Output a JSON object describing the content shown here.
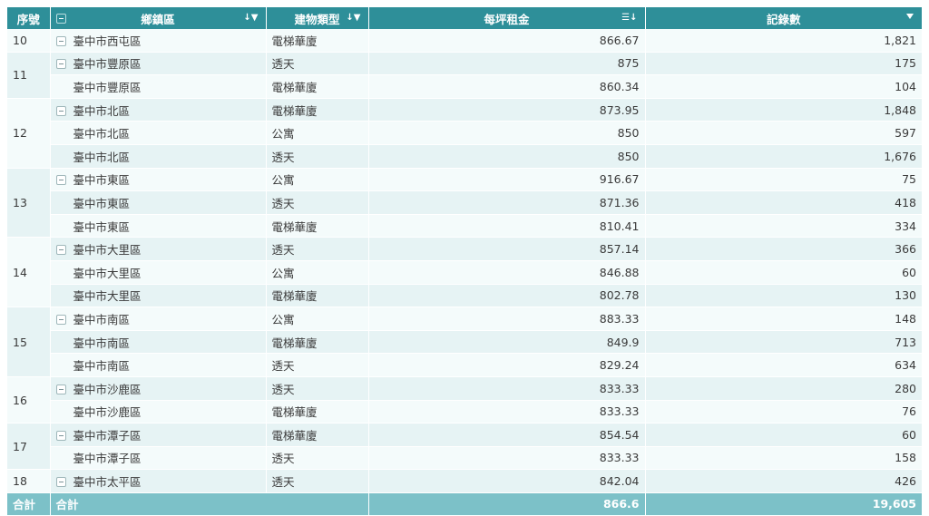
{
  "headers": {
    "seq": "序號",
    "district": "鄉鎮區",
    "type": "建物類型",
    "rent": "每坪租金",
    "count": "記錄數"
  },
  "groups": [
    {
      "seq": "10",
      "rows": [
        {
          "district": "臺中市西屯區",
          "type": "電梯華廈",
          "rent": "866.67",
          "count": "1,821"
        }
      ]
    },
    {
      "seq": "11",
      "rows": [
        {
          "district": "臺中市豐原區",
          "type": "透天",
          "rent": "875",
          "count": "175"
        },
        {
          "district": "臺中市豐原區",
          "type": "電梯華廈",
          "rent": "860.34",
          "count": "104"
        }
      ]
    },
    {
      "seq": "12",
      "rows": [
        {
          "district": "臺中市北區",
          "type": "電梯華廈",
          "rent": "873.95",
          "count": "1,848"
        },
        {
          "district": "臺中市北區",
          "type": "公寓",
          "rent": "850",
          "count": "597"
        },
        {
          "district": "臺中市北區",
          "type": "透天",
          "rent": "850",
          "count": "1,676"
        }
      ]
    },
    {
      "seq": "13",
      "rows": [
        {
          "district": "臺中市東區",
          "type": "公寓",
          "rent": "916.67",
          "count": "75"
        },
        {
          "district": "臺中市東區",
          "type": "透天",
          "rent": "871.36",
          "count": "418"
        },
        {
          "district": "臺中市東區",
          "type": "電梯華廈",
          "rent": "810.41",
          "count": "334"
        }
      ]
    },
    {
      "seq": "14",
      "rows": [
        {
          "district": "臺中市大里區",
          "type": "透天",
          "rent": "857.14",
          "count": "366"
        },
        {
          "district": "臺中市大里區",
          "type": "公寓",
          "rent": "846.88",
          "count": "60"
        },
        {
          "district": "臺中市大里區",
          "type": "電梯華廈",
          "rent": "802.78",
          "count": "130"
        }
      ]
    },
    {
      "seq": "15",
      "rows": [
        {
          "district": "臺中市南區",
          "type": "公寓",
          "rent": "883.33",
          "count": "148"
        },
        {
          "district": "臺中市南區",
          "type": "電梯華廈",
          "rent": "849.9",
          "count": "713"
        },
        {
          "district": "臺中市南區",
          "type": "透天",
          "rent": "829.24",
          "count": "634"
        }
      ]
    },
    {
      "seq": "16",
      "rows": [
        {
          "district": "臺中市沙鹿區",
          "type": "透天",
          "rent": "833.33",
          "count": "280"
        },
        {
          "district": "臺中市沙鹿區",
          "type": "電梯華廈",
          "rent": "833.33",
          "count": "76"
        }
      ]
    },
    {
      "seq": "17",
      "rows": [
        {
          "district": "臺中市潭子區",
          "type": "電梯華廈",
          "rent": "854.54",
          "count": "60"
        },
        {
          "district": "臺中市潭子區",
          "type": "透天",
          "rent": "833.33",
          "count": "158"
        }
      ]
    },
    {
      "seq": "18",
      "rows": [
        {
          "district": "臺中市太平區",
          "type": "透天",
          "rent": "842.04",
          "count": "426"
        }
      ]
    }
  ],
  "total": {
    "seq_label": "合計",
    "district_label": "合計",
    "rent": "866.6",
    "count": "19,605"
  },
  "icons": {
    "district_sort": "sort-icon",
    "type_sort": "sort-icon",
    "rent_sort": "sort-desc-icon",
    "count_filter": "filter-icon"
  },
  "colors": {
    "header_bg": "#2e8f99",
    "total_bg": "#7cc1c8",
    "row_light": "#f4fbfb",
    "row_dark": "#e6f3f4"
  }
}
